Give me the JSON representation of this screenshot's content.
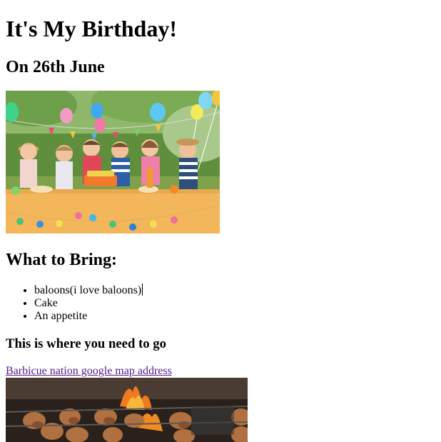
{
  "page": {
    "title": "It's My Birthday!",
    "date_heading": "On 26th June",
    "bring_heading": "What to Bring:",
    "bring_items": [
      "baloons(i love baloons)",
      "Cake",
      "An appetite"
    ],
    "directions_heading": "This is where you need to go",
    "map_link_text": "Barbicue nation google map address"
  },
  "images": {
    "party_photo": "kids-birthday-party-photo",
    "bbq_photo": "barbecue-grill-photo"
  },
  "colors": {
    "visited_link": "#551a8b",
    "text": "#000000",
    "background": "#ffffff"
  }
}
